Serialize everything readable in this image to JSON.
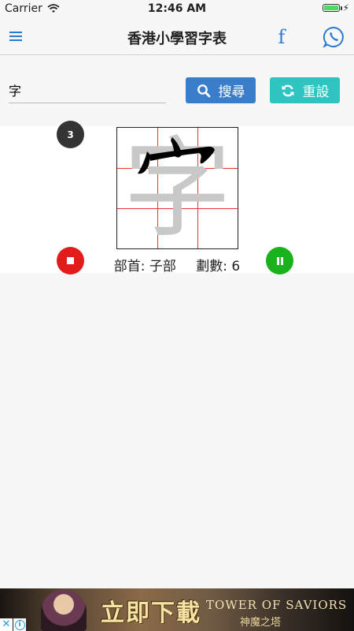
{
  "status_bar": {
    "carrier": "Carrier",
    "time": "12:46 AM",
    "battery_level": 1.0
  },
  "nav": {
    "title": "香港小學習字表",
    "menu_icon": "hamburger-menu-icon",
    "facebook_icon": "facebook-icon",
    "facebook_glyph": "f",
    "whatsapp_icon": "whatsapp-icon"
  },
  "search": {
    "input_value": "字",
    "search_label": "搜尋",
    "search_icon": "search-icon",
    "reset_label": "重設",
    "reset_icon": "refresh-icon"
  },
  "character": {
    "glyph": "字",
    "current_stroke": "3",
    "radical_text": "部首: 子部",
    "stroke_count_text": "劃數: 6",
    "stop_icon": "stop-icon",
    "pause_icon": "pause-icon"
  },
  "ad": {
    "headline": "立即下載",
    "brand": "TOWER OF SAVIORS",
    "brand_sub": "神魔之塔",
    "close_glyph": "✕",
    "info_glyph": "i"
  },
  "colors": {
    "accent_blue": "#3a7ecb",
    "reset_teal": "#2fc3c1",
    "stop_red": "#e21b1b",
    "pause_green": "#19b21c",
    "grid_red": "#e33333"
  }
}
